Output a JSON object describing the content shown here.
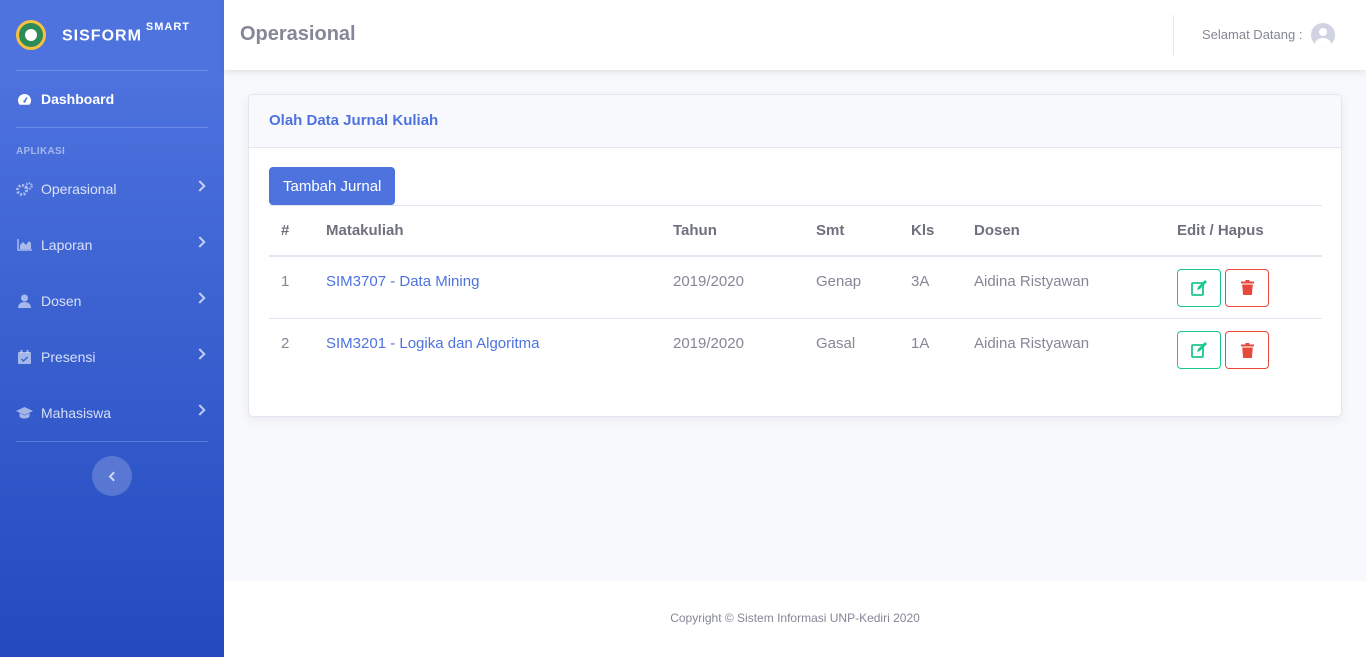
{
  "sidebar": {
    "brand": {
      "name": "SISFORM",
      "superscript": "SMART"
    },
    "dashboard_label": "Dashboard",
    "section_heading": "APLIKASI",
    "items": [
      {
        "label": "Operasional",
        "icon": "cogs-icon"
      },
      {
        "label": "Laporan",
        "icon": "chart-area-icon"
      },
      {
        "label": "Dosen",
        "icon": "user-icon"
      },
      {
        "label": "Presensi",
        "icon": "calendar-check-icon"
      },
      {
        "label": "Mahasiswa",
        "icon": "graduation-cap-icon"
      }
    ]
  },
  "topbar": {
    "title": "Operasional",
    "welcome": "Selamat Datang :"
  },
  "card": {
    "title": "Olah Data Jurnal Kuliah",
    "add_button": "Tambah Jurnal",
    "columns": [
      "#",
      "Matakuliah",
      "Tahun",
      "Smt",
      "Kls",
      "Dosen",
      "Edit / Hapus"
    ],
    "rows": [
      {
        "no": "1",
        "matakuliah": "SIM3707 - Data Mining",
        "tahun": "2019/2020",
        "smt": "Genap",
        "kls": "3A",
        "dosen": "Aidina Ristyawan"
      },
      {
        "no": "2",
        "matakuliah": "SIM3201 - Logika dan Algoritma",
        "tahun": "2019/2020",
        "smt": "Gasal",
        "kls": "1A",
        "dosen": "Aidina Ristyawan"
      }
    ]
  },
  "footer": {
    "text": "Copyright © Sistem Informasi UNP-Kediri 2020"
  },
  "colors": {
    "primary": "#4e73df",
    "success": "#1cc88a",
    "danger": "#e74a3b"
  }
}
